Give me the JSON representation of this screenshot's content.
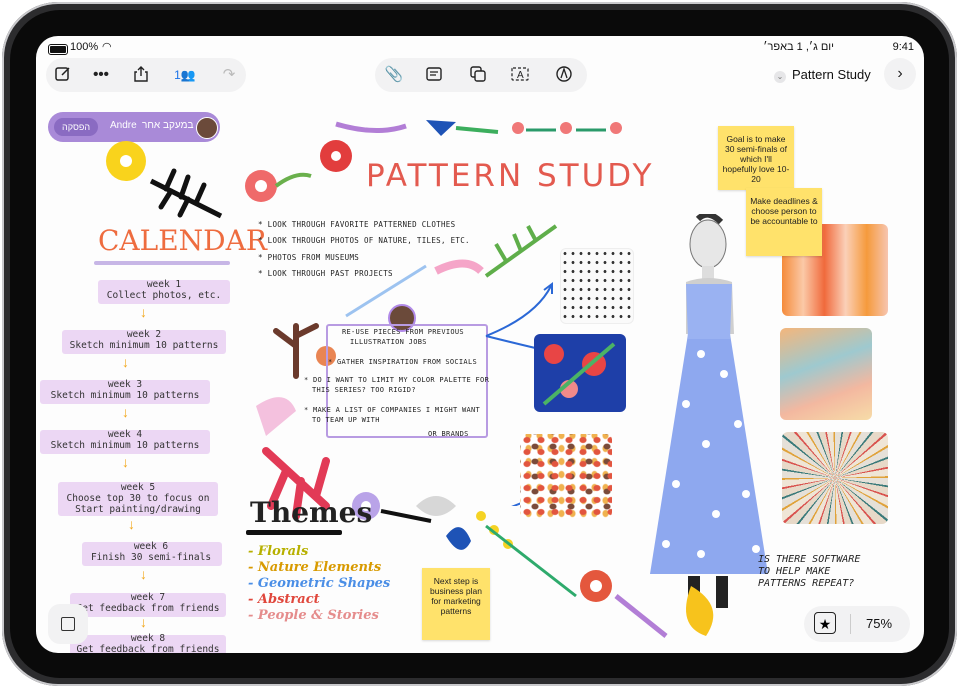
{
  "status": {
    "battery": "100%",
    "time": "9:41",
    "date": "יום ג׳, 1 באפר׳"
  },
  "toolbar": {
    "participants": "1",
    "board_title": "Pattern Study"
  },
  "following": {
    "name": "Andre",
    "label": "במעקב אחר",
    "stop": "הפסקה"
  },
  "board": {
    "title": "PATTERN STUDY",
    "calendar_title": "CALENDAR",
    "weeks": [
      {
        "label": "week 1",
        "task": "Collect photos, etc."
      },
      {
        "label": "week 2",
        "task": "Sketch minimum 10 patterns"
      },
      {
        "label": "week 3",
        "task": "Sketch minimum 10 patterns"
      },
      {
        "label": "week 4",
        "task": "Sketch minimum 10 patterns"
      },
      {
        "label": "week 5",
        "task": "Choose top 30 to focus on",
        "task2": "Start painting/drawing"
      },
      {
        "label": "week 6",
        "task": "Finish 30 semi-finals"
      },
      {
        "label": "week 7",
        "task": "Get feedback from friends"
      },
      {
        "label": "week 8",
        "task": "Get feedback from friends"
      }
    ],
    "todo": [
      "* LOOK THROUGH FAVORITE PATTERNED CLOTHES",
      "* LOOK THROUGH PHOTOS OF NATURE, TILES, ETC.",
      "* PHOTOS FROM MUSEUMS",
      "* LOOK THROUGH PAST PROJECTS"
    ],
    "ideas": [
      "RE-USE PIECES FROM PREVIOUS",
      "ILLUSTRATION JOBS",
      "* GATHER INSPIRATION FROM SOCIALS",
      "* DO I WANT TO LIMIT MY COLOR PALETTE FOR",
      "THIS SERIES? TOO RIGID?",
      "* MAKE A LIST OF COMPANIES I MIGHT WANT",
      "TO TEAM UP WITH",
      "OR BRANDS"
    ],
    "themes_title": "Themes",
    "themes": [
      {
        "text": "- Florals",
        "color": "#b7b000"
      },
      {
        "text": "- Nature Elements",
        "color": "#d89a00"
      },
      {
        "text": "- Geometric Shapes",
        "color": "#4a8ee6"
      },
      {
        "text": "- Abstract",
        "color": "#e0473c"
      },
      {
        "text": "- People & Stories",
        "color": "#e58c8c"
      }
    ],
    "notes": [
      "Goal is to make 30 semi-finals of which I'll hopefully love 10-20",
      "Make deadlines & choose person to be accountable to",
      "Next step is business plan for marketing patterns"
    ],
    "question": [
      "IS THERE SOFTWARE",
      "TO HELP MAKE",
      "PATTERNS REPEAT?"
    ]
  },
  "zoom": "75%",
  "colors": {
    "accent_purple": "#a98ad8",
    "note_yellow": "#ffe26b",
    "title_red": "#e35a4f"
  }
}
